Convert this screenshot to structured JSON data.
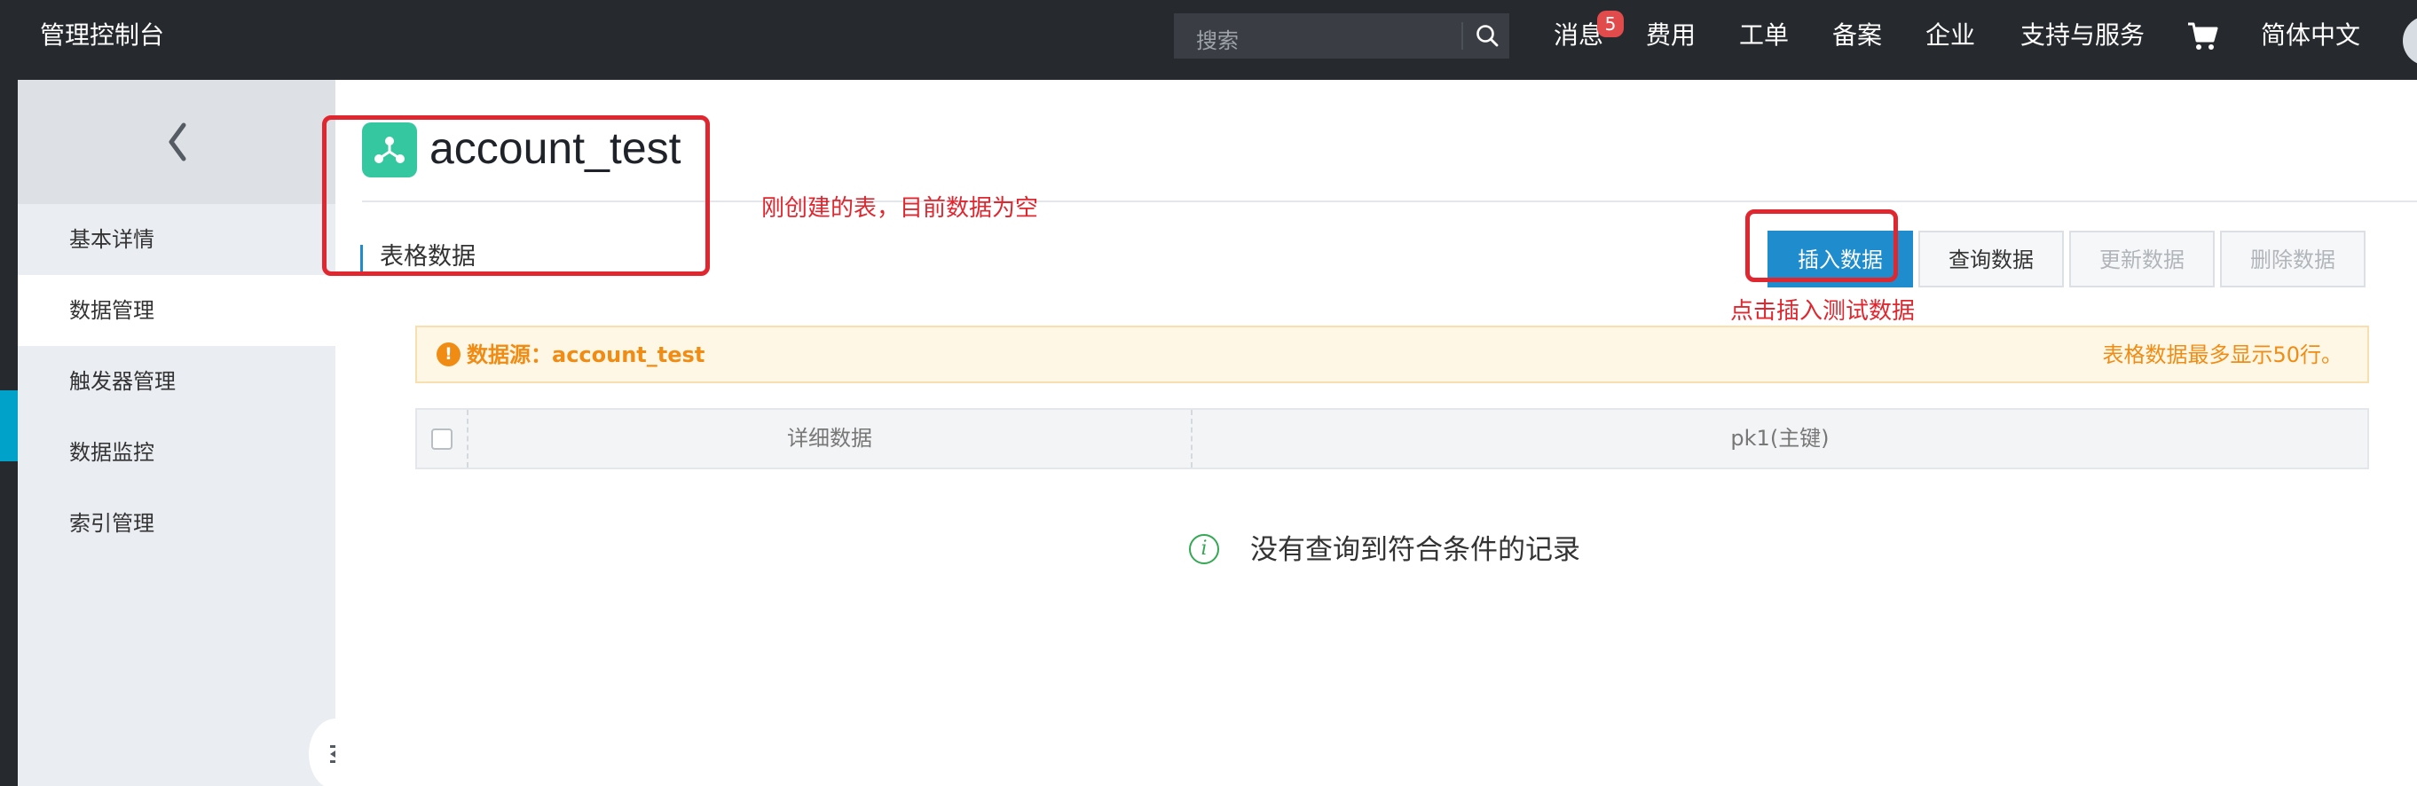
{
  "topbar": {
    "brand": "管理控制台",
    "search": {
      "placeholder": "搜索",
      "icon": "search-icon"
    },
    "nav": {
      "messages": "消息",
      "messages_badge": "5",
      "billing": "费用",
      "tickets": "工单",
      "filing": "备案",
      "enterprise": "企业",
      "support": "支持与服务",
      "cart_icon": "cart-icon",
      "language": "简体中文"
    }
  },
  "sidebar": {
    "back_icon": "chevron-left-icon",
    "items": [
      {
        "label": "基本详情",
        "active": false
      },
      {
        "label": "数据管理",
        "active": true
      },
      {
        "label": "触发器管理",
        "active": false
      },
      {
        "label": "数据监控",
        "active": false
      },
      {
        "label": "索引管理",
        "active": false
      }
    ],
    "collapse_icon": "collapse-sidebar-icon"
  },
  "main": {
    "title_icon": "table-store-icon",
    "title": "account_test",
    "section_title": "表格数据",
    "buttons": {
      "insert": "插入数据",
      "query": "查询数据",
      "update": "更新数据",
      "delete": "删除数据"
    },
    "notice": {
      "icon": "!",
      "left": "数据源：account_test",
      "right": "表格数据最多显示50行。"
    },
    "table": {
      "columns": [
        "详细数据",
        "pk1(主键)"
      ]
    },
    "empty": {
      "icon": "i",
      "text": "没有查询到符合条件的记录"
    }
  },
  "annotations": {
    "table_empty": "刚创建的表，目前数据为空",
    "click_insert": "点击插入测试数据",
    "color": "#e0262e"
  },
  "colors": {
    "topbar": "#262a2f",
    "accent": "#1e8ccd",
    "sidebar_active_strip": "#00a2ca",
    "notice_text": "#f08c13",
    "badge": "#e24b4b"
  }
}
